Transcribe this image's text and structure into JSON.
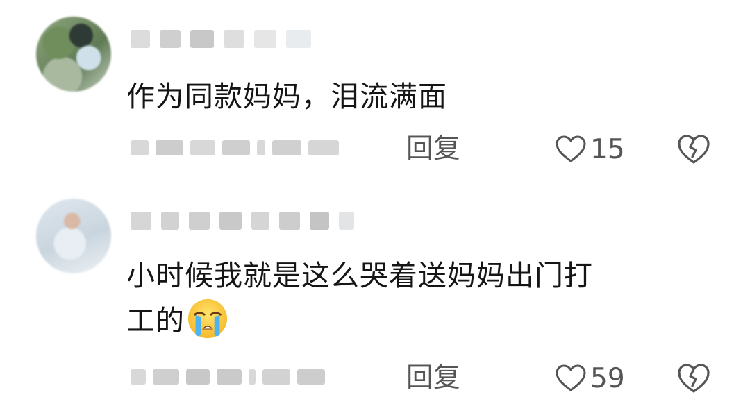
{
  "comments": [
    {
      "text": "作为同款妈妈，泪流满面",
      "reply_label": "回复",
      "likes": "15",
      "has_emoji": false
    },
    {
      "text": "小时候我就是这么哭着送妈妈出门打",
      "text_line2": "工的",
      "emoji": "loudly-crying-face",
      "reply_label": "回复",
      "likes": "59",
      "has_emoji": true
    }
  ],
  "colors": {
    "text": "#151515",
    "meta": "#555555",
    "blur": "#d8d8d8"
  },
  "icons": [
    "heart-outline-icon",
    "broken-heart-icon",
    "loudly-crying-face-emoji"
  ]
}
